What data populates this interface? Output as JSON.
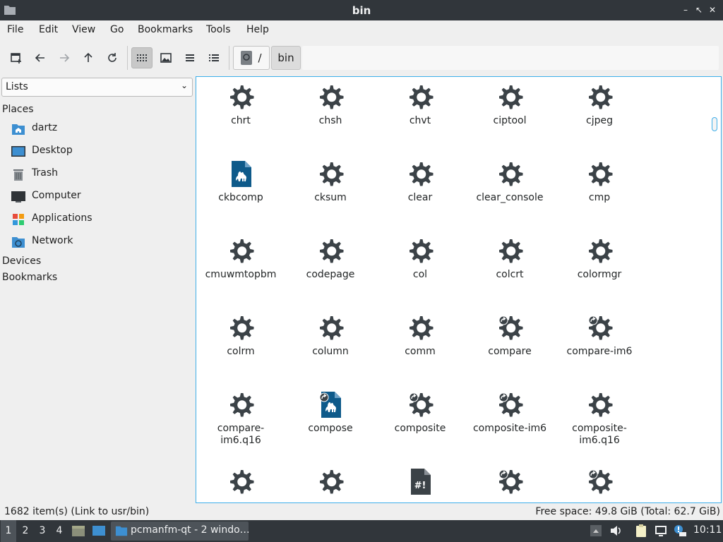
{
  "window": {
    "title": "bin",
    "controls": [
      "–",
      "↖",
      "⤢",
      "✕"
    ]
  },
  "menu": [
    "File",
    "Edit",
    "Go",
    "Bookmarks",
    "Tools",
    "Help"
  ],
  "menu_full": [
    "File",
    "Edit",
    "View",
    "Go",
    "Bookmarks",
    "Tools",
    "Help"
  ],
  "path": {
    "root_label": "/",
    "current": "bin"
  },
  "sidebar": {
    "mode": "Lists",
    "places_header": "Places",
    "places": [
      {
        "label": "dartz",
        "icon": "home-folder-icon"
      },
      {
        "label": "Desktop",
        "icon": "desktop-icon"
      },
      {
        "label": "Trash",
        "icon": "trash-icon"
      },
      {
        "label": "Computer",
        "icon": "computer-icon"
      },
      {
        "label": "Applications",
        "icon": "applications-icon"
      },
      {
        "label": "Network",
        "icon": "network-folder-icon"
      }
    ],
    "devices_header": "Devices",
    "bookmarks_header": "Bookmarks"
  },
  "files": [
    {
      "name": "chrt",
      "icon": "gear"
    },
    {
      "name": "chsh",
      "icon": "gear"
    },
    {
      "name": "chvt",
      "icon": "gear"
    },
    {
      "name": "ciptool",
      "icon": "gear"
    },
    {
      "name": "cjpeg",
      "icon": "gear"
    },
    {
      "name": "ckbcomp",
      "icon": "perl"
    },
    {
      "name": "cksum",
      "icon": "gear"
    },
    {
      "name": "clear",
      "icon": "gear"
    },
    {
      "name": "clear_console",
      "icon": "gear"
    },
    {
      "name": "cmp",
      "icon": "gear"
    },
    {
      "name": "cmuwmtopbm",
      "icon": "gear"
    },
    {
      "name": "codepage",
      "icon": "gear"
    },
    {
      "name": "col",
      "icon": "gear"
    },
    {
      "name": "colcrt",
      "icon": "gear"
    },
    {
      "name": "colormgr",
      "icon": "gear"
    },
    {
      "name": "colrm",
      "icon": "gear"
    },
    {
      "name": "column",
      "icon": "gear"
    },
    {
      "name": "comm",
      "icon": "gear"
    },
    {
      "name": "compare",
      "icon": "gear-link"
    },
    {
      "name": "compare-im6",
      "icon": "gear-link"
    },
    {
      "name": "compare-\nim6.q16",
      "icon": "gear"
    },
    {
      "name": "compose",
      "icon": "perl-link"
    },
    {
      "name": "composite",
      "icon": "gear-link"
    },
    {
      "name": "composite-im6",
      "icon": "gear-link"
    },
    {
      "name": "composite-\nim6.q16",
      "icon": "gear"
    },
    {
      "name": "",
      "icon": "gear"
    },
    {
      "name": "",
      "icon": "gear"
    },
    {
      "name": "",
      "icon": "script"
    },
    {
      "name": "",
      "icon": "gear-link"
    },
    {
      "name": "",
      "icon": "gear-link"
    }
  ],
  "status": {
    "left": "1682 item(s) (Link to usr/bin)",
    "right": "Free space: 49.8 GiB (Total: 62.7 GiB)"
  },
  "taskbar": {
    "workspaces": [
      "1",
      "2",
      "3",
      "4"
    ],
    "task_label": "pcmanfm-qt - 2 windo…",
    "clock": "10:11"
  },
  "colors": {
    "accent": "#3daee9",
    "gear": "#3b4247",
    "perl": "#0e5a8a",
    "panel": "#31363b"
  }
}
